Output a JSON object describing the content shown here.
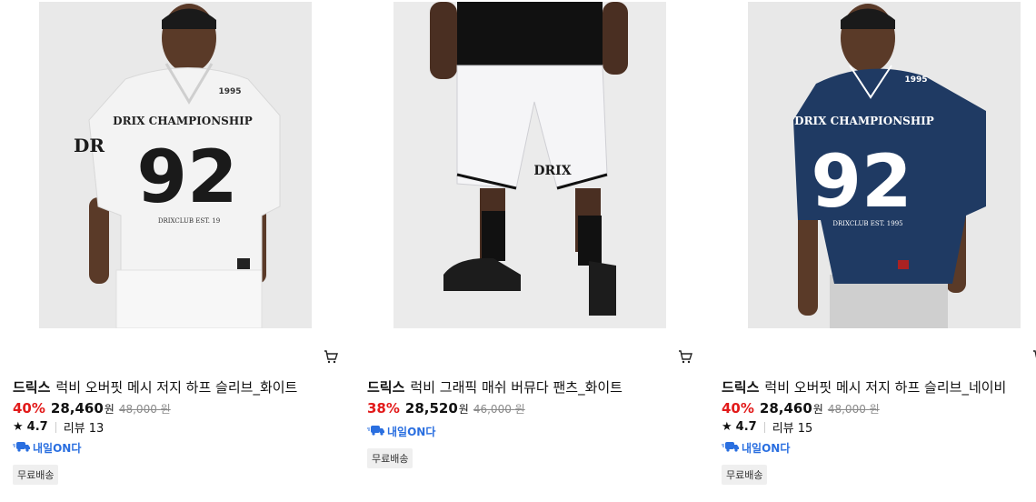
{
  "products": [
    {
      "brand": "드릭스",
      "name": "럭비 오버핏 메시 저지 하프 슬리브_화이트",
      "discount": "40%",
      "price": "28,460",
      "currency": "원",
      "original_price": "48,000",
      "original_currency": "원",
      "rating": "4.7",
      "review_label": "리뷰 13",
      "delivery_badge": "내일ON다",
      "free_shipping": "무료배송",
      "image_jersey_text": "DRIX CHAMPIONSHIP",
      "image_number": "92",
      "image_small_text": "DRIXCLUB EST. 19",
      "image_year": "1995",
      "image_sleeve": "DR",
      "garment_color": "#f2f2f2"
    },
    {
      "brand": "드릭스",
      "name": "럭비 그래픽 매쉬 버뮤다 팬츠_화이트",
      "discount": "38%",
      "price": "28,520",
      "currency": "원",
      "original_price": "46,000",
      "original_currency": "원",
      "delivery_badge": "내일ON다",
      "free_shipping": "무료배송",
      "image_logo": "DRIX",
      "garment_color": "#f4f4f6"
    },
    {
      "brand": "드릭스",
      "name": "럭비 오버핏 메시 저지 하프 슬리브_네이비",
      "discount": "40%",
      "price": "28,460",
      "currency": "원",
      "original_price": "48,000",
      "original_currency": "원",
      "rating": "4.7",
      "review_label": "리뷰 15",
      "delivery_badge": "내일ON다",
      "free_shipping": "무료배송",
      "image_jersey_text": "DRIX CHAMPIONSHIP",
      "image_number": "92",
      "image_small_text": "DRIXCLUB EST. 1995",
      "image_year": "1995",
      "garment_color": "#1f3a63"
    }
  ],
  "icons": {
    "cart": "shopping-cart-icon",
    "star": "star-icon",
    "delivery": "delivery-truck-icon"
  },
  "colors": {
    "discount": "#e21a1a",
    "delivery": "#2a6fe0"
  }
}
